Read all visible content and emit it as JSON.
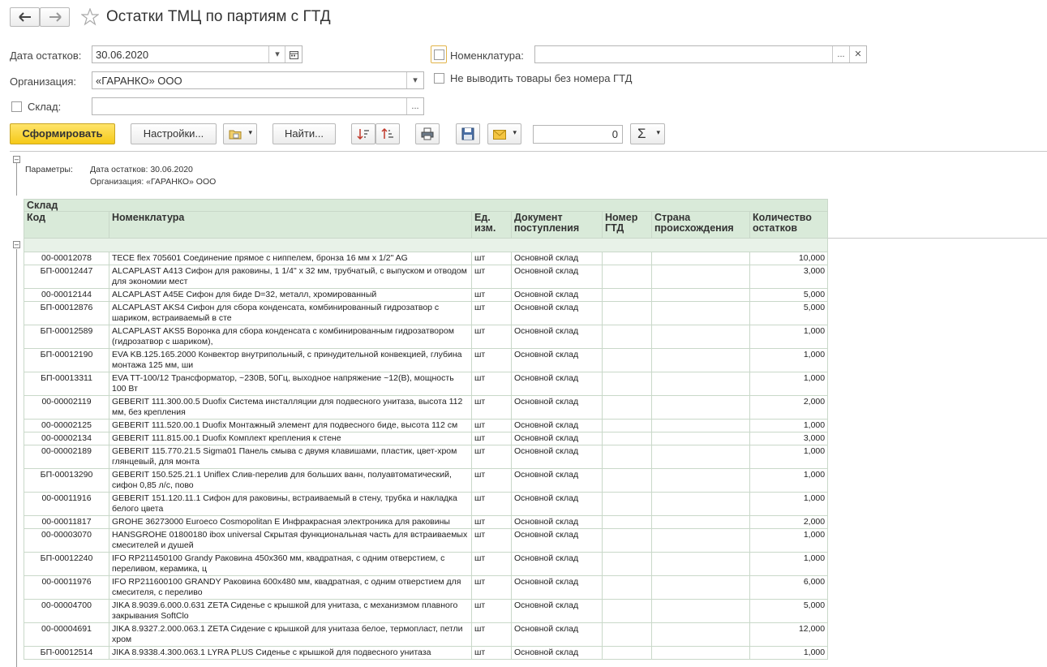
{
  "title": "Остатки ТМЦ по партиям с ГТД",
  "form": {
    "date_label": "Дата остатков:",
    "date_value": "30.06.2020",
    "org_label": "Организация:",
    "org_value": "«ГАРАНКО» ООО",
    "warehouse_label": "Склад:",
    "warehouse_value": "",
    "nomenclature_label": "Номенклатура:",
    "nomenclature_value": "",
    "no_gtd_label": "Не выводить товары без номера ГТД"
  },
  "toolbar": {
    "generate": "Сформировать",
    "settings": "Настройки...",
    "find": "Найти...",
    "counter": "0",
    "sum_symbol": "Σ"
  },
  "params": {
    "label": "Параметры:",
    "line1": "Дата остатков: 30.06.2020",
    "line2": "Организация: «ГАРАНКО» ООО"
  },
  "table": {
    "group_header": "Склад",
    "columns": [
      "Код",
      "Номенклатура",
      "Ед. изм.",
      "Документ поступления",
      "Номер ГТД",
      "Страна происхождения",
      "Количество остатков"
    ],
    "rows": [
      {
        "code": "00-00012078",
        "name": "TECE flex 705601 Соединение прямое с ниппелем, бронза 16 мм x 1/2\" AG",
        "unit": "шт",
        "doc": "Основной склад",
        "gtd": "",
        "country": "",
        "qty": "10,000"
      },
      {
        "code": "БП-00012447",
        "name": "ALCAPLAST A413 Сифон для раковины, 1 1/4\" x 32 мм, трубчатый, с выпуском и отводом для экономии мест",
        "unit": "шт",
        "doc": "Основной склад",
        "gtd": "",
        "country": "",
        "qty": "3,000"
      },
      {
        "code": "00-00012144",
        "name": "ALCAPLAST A45E Сифон для биде D=32, металл, хромированный",
        "unit": "шт",
        "doc": "Основной склад",
        "gtd": "",
        "country": "",
        "qty": "5,000"
      },
      {
        "code": "БП-00012876",
        "name": "ALCAPLAST AKS4 Сифон для сбора конденсата, комбинированный гидрозатвор с шариком, встраиваемый в сте",
        "unit": "шт",
        "doc": "Основной склад",
        "gtd": "",
        "country": "",
        "qty": "5,000"
      },
      {
        "code": "БП-00012589",
        "name": "ALCAPLAST AKS5 Воронка для сбора конденсата с комбинированным гидрозатвором (гидрозатвор с шариком),",
        "unit": "шт",
        "doc": "Основной склад",
        "gtd": "",
        "country": "",
        "qty": "1,000"
      },
      {
        "code": "БП-00012190",
        "name": "EVA KB.125.165.2000 Конвектор внутрипольный, с принудительной конвекцией, глубина монтажа 125 мм, ши",
        "unit": "шт",
        "doc": "Основной склад",
        "gtd": "",
        "country": "",
        "qty": "1,000"
      },
      {
        "code": "БП-00013311",
        "name": "EVA TT-100/12 Трансформатор, ~230В, 50Гц, выходное напряжение ~12(В), мощность 100 Вт",
        "unit": "шт",
        "doc": "Основной склад",
        "gtd": "",
        "country": "",
        "qty": "1,000"
      },
      {
        "code": "00-00002119",
        "name": "GEBERIT 111.300.00.5 Duofix Система инсталляции для подвесного унитаза, высота 112 мм, без крепления",
        "unit": "шт",
        "doc": "Основной склад",
        "gtd": "",
        "country": "",
        "qty": "2,000"
      },
      {
        "code": "00-00002125",
        "name": "GEBERIT 111.520.00.1 Duofix Монтажный элемент для подвесного биде, высота 112 см",
        "unit": "шт",
        "doc": "Основной склад",
        "gtd": "",
        "country": "",
        "qty": "1,000"
      },
      {
        "code": "00-00002134",
        "name": "GEBERIT 111.815.00.1 Duofix Комплект крепления к стене",
        "unit": "шт",
        "doc": "Основной склад",
        "gtd": "",
        "country": "",
        "qty": "3,000"
      },
      {
        "code": "00-00002189",
        "name": "GEBERIT 115.770.21.5 Sigma01 Панель смыва с двумя клавишами, пластик, цвет-хром глянцевый, для монта",
        "unit": "шт",
        "doc": "Основной склад",
        "gtd": "",
        "country": "",
        "qty": "1,000"
      },
      {
        "code": "БП-00013290",
        "name": "GEBERIT 150.525.21.1 Uniflex Слив-перелив для больших ванн, полуавтоматический, сифон 0,85 л/с, пово",
        "unit": "шт",
        "doc": "Основной склад",
        "gtd": "",
        "country": "",
        "qty": "1,000"
      },
      {
        "code": "00-00011916",
        "name": "GEBERIT 151.120.11.1 Сифон для раковины, встраиваемый в стену, трубка и накладка белого цвета",
        "unit": "шт",
        "doc": "Основной склад",
        "gtd": "",
        "country": "",
        "qty": "1,000"
      },
      {
        "code": "00-00011817",
        "name": "GROHE 36273000 Euroeco Cosmopolitan E Инфракрасная электроника для раковины",
        "unit": "шт",
        "doc": "Основной склад",
        "gtd": "",
        "country": "",
        "qty": "2,000"
      },
      {
        "code": "00-00003070",
        "name": "HANSGROHE 01800180 ibox universal Скрытая функциональная часть для встраиваемых смесителей и душей",
        "unit": "шт",
        "doc": "Основной склад",
        "gtd": "",
        "country": "",
        "qty": "1,000"
      },
      {
        "code": "БП-00012240",
        "name": "IFO RP211450100 Grandy Раковина 450x360 мм, квадратная, с одним отверстием, с переливом, керамика, ц",
        "unit": "шт",
        "doc": "Основной склад",
        "gtd": "",
        "country": "",
        "qty": "1,000"
      },
      {
        "code": "00-00011976",
        "name": "IFO RP211600100 GRANDY Раковина 600x480 мм, квадратная, с одним отверстием для смесителя, с переливо",
        "unit": "шт",
        "doc": "Основной склад",
        "gtd": "",
        "country": "",
        "qty": "6,000"
      },
      {
        "code": "00-00004700",
        "name": "JIKA 8.9039.6.000.0.631 ZETA Сиденье с крышкой для унитаза, с механизмом плавного закрывания SoftClo",
        "unit": "шт",
        "doc": "Основной склад",
        "gtd": "",
        "country": "",
        "qty": "5,000"
      },
      {
        "code": "00-00004691",
        "name": "JIKA 8.9327.2.000.063.1 ZETA Сидение с крышкой для унитаза белое, термопласт, петли хром",
        "unit": "шт",
        "doc": "Основной склад",
        "gtd": "",
        "country": "",
        "qty": "12,000"
      },
      {
        "code": "БП-00012514",
        "name": "JIKA 8.9338.4.300.063.1 LYRA PLUS Сиденье с крышкой для подвесного унитаза",
        "unit": "шт",
        "doc": "Основной склад",
        "gtd": "",
        "country": "",
        "qty": "1,000"
      }
    ]
  }
}
